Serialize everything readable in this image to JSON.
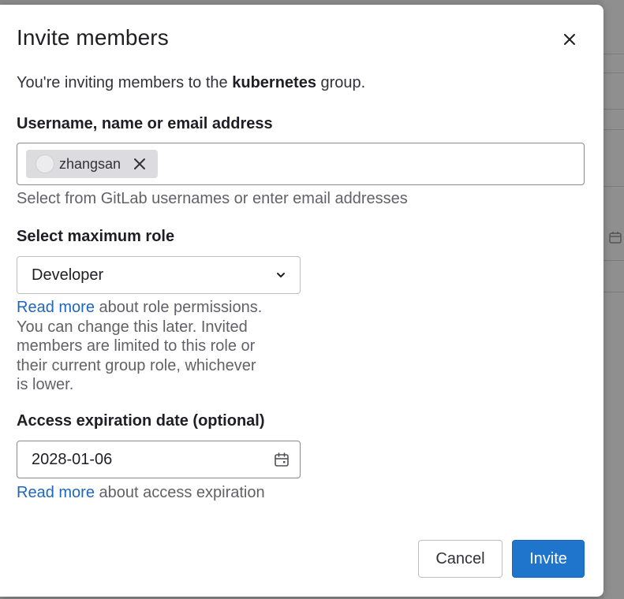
{
  "modal": {
    "title": "Invite members",
    "intro_prefix": "You're inviting members to the ",
    "intro_group": "kubernetes",
    "intro_suffix": " group."
  },
  "members": {
    "label": "Username, name or email address",
    "tokens": [
      {
        "username": "zhangsan"
      }
    ],
    "help": "Select from GitLab usernames or enter email addresses"
  },
  "role": {
    "label": "Select maximum role",
    "selected": "Developer",
    "help_link": "Read more",
    "help_text_1": " about role permissions.",
    "help_text_2": "You can change this later. Invited",
    "help_text_3": "members are limited to this role or",
    "help_text_4": "their current group role, whichever",
    "help_text_5": "is lower."
  },
  "expiration": {
    "label": "Access expiration date (optional)",
    "value": "2028-01-06",
    "help_link": "Read more",
    "help_text": " about access expiration"
  },
  "footer": {
    "cancel_label": "Cancel",
    "invite_label": "Invite"
  },
  "colors": {
    "primary": "#1f75cb",
    "link": "#1f67ba"
  },
  "icons": {
    "close": "close-icon",
    "remove_token": "close-icon",
    "dropdown": "chevron-down-icon",
    "date": "calendar-icon"
  }
}
